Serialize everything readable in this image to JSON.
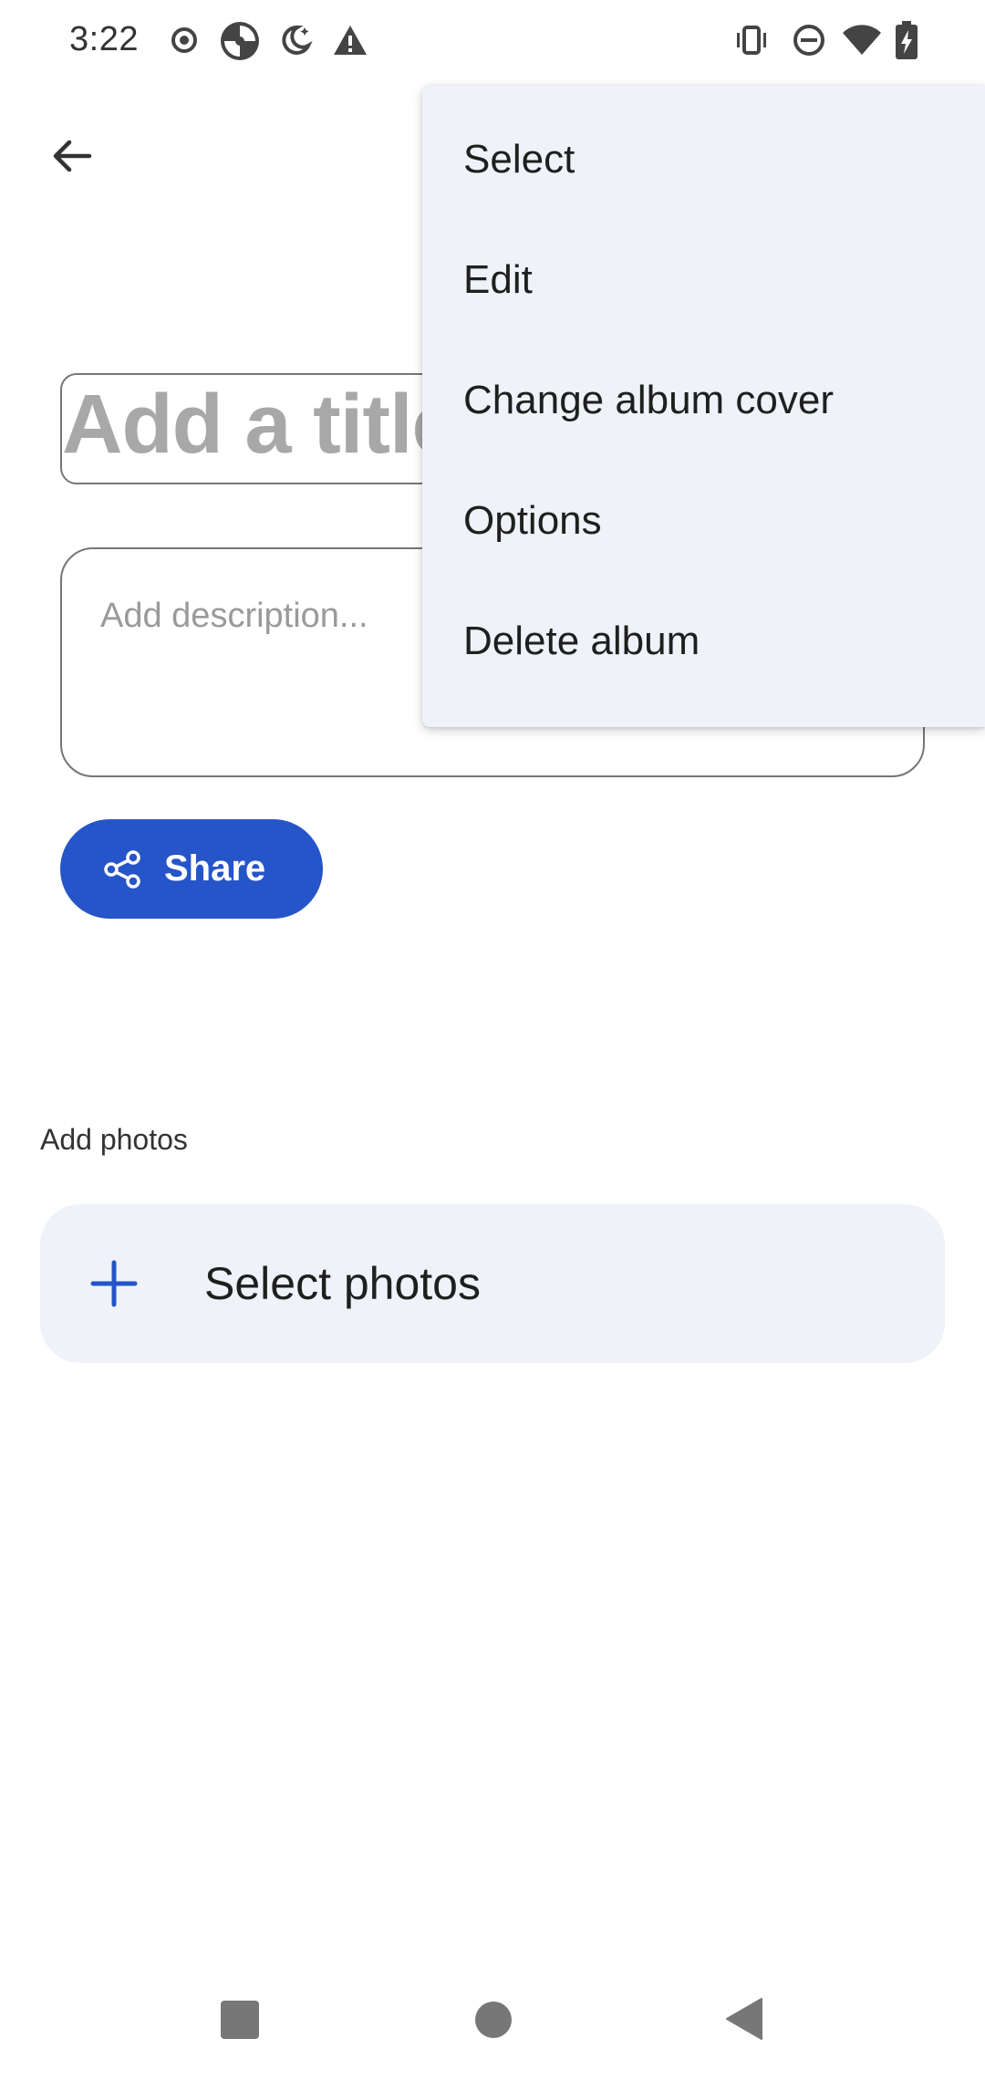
{
  "status_bar": {
    "time": "3:22",
    "icons_left": [
      "record-icon",
      "camera-shutter-icon",
      "night-mode-icon",
      "warning-icon"
    ],
    "icons_right": [
      "vibrate-icon",
      "do-not-disturb-icon",
      "wifi-icon",
      "battery-charging-icon"
    ]
  },
  "header": {
    "back_icon": "arrow-back-icon"
  },
  "album": {
    "title_placeholder": "Add a title",
    "description_placeholder": "Add description..."
  },
  "share_button": {
    "label": "Share",
    "icon": "share-icon"
  },
  "add_photos": {
    "section_label": "Add photos",
    "select_label": "Select photos",
    "icon": "plus-icon"
  },
  "overflow_menu": {
    "items": [
      {
        "label": "Select"
      },
      {
        "label": "Edit"
      },
      {
        "label": "Change album cover"
      },
      {
        "label": "Options"
      },
      {
        "label": "Delete album"
      }
    ]
  },
  "nav_bar": {
    "buttons": [
      "recents-button",
      "home-button",
      "back-button"
    ]
  },
  "colors": {
    "accent": "#2654c9",
    "menu_bg": "#eff2f8",
    "card_bg": "#eff3f9"
  }
}
